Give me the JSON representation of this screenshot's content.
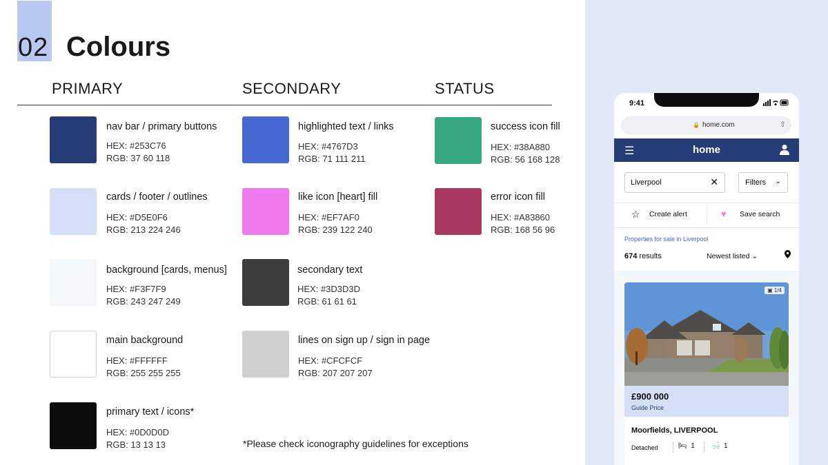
{
  "header": {
    "number": "02",
    "title": "Colours"
  },
  "columns": {
    "primary": "PRIMARY",
    "secondary": "SECONDARY",
    "status": "STATUS"
  },
  "primary": [
    {
      "label": "nav bar / primary buttons",
      "hex": "HEX: #253C76",
      "rgb": "RGB: 37 60 118",
      "color": "#253C76"
    },
    {
      "label": "cards / footer / outlines",
      "hex": "HEX: #D5E0F6",
      "rgb": "RGB: 213 224 246",
      "color": "#D5E0F6"
    },
    {
      "label": "background [cards, menus]",
      "hex": "HEX: #F3F7F9",
      "rgb": "RGB: 243 247 249",
      "color": "#F3F7F9"
    },
    {
      "label": "main background",
      "hex": "HEX: #FFFFFF",
      "rgb": "RGB: 255 255 255",
      "color": "#FFFFFF"
    },
    {
      "label": "primary text / icons*",
      "hex": "HEX: #0D0D0D",
      "rgb": "RGB: 13 13 13",
      "color": "#0D0D0D"
    }
  ],
  "secondary": [
    {
      "label": "highlighted text / links",
      "hex": "HEX: #4767D3",
      "rgb": "RGB: 71 111 211",
      "color": "#4767D3"
    },
    {
      "label": "like icon [heart] fill",
      "hex": "HEX: #EF7AF0",
      "rgb": "RGB: 239 122 240",
      "color": "#EF7AF0"
    },
    {
      "label": "secondary text",
      "hex": "HEX: #3D3D3D",
      "rgb": "RGB: 61 61 61",
      "color": "#3D3D3D"
    },
    {
      "label": "lines on sign up / sign in page",
      "hex": "HEX: #CFCFCF",
      "rgb": "RGB: 207 207 207",
      "color": "#CFCFCF"
    }
  ],
  "status": [
    {
      "label": "success icon fill",
      "hex": "HEX: #38A880",
      "rgb": "RGB: 56 168 128",
      "color": "#38A880"
    },
    {
      "label": "error icon fill",
      "hex": "HEX: #A83860",
      "rgb": "RGB: 168 56 96",
      "color": "#A83860"
    }
  ],
  "footnote": "*Please check iconography guidelines for exceptions",
  "phone": {
    "time": "9:41",
    "url": "home.com",
    "brand": "home",
    "location_value": "Liverpool",
    "filters_label": "Filters",
    "create_alert": "Create alert",
    "save_search": "Save search",
    "breadcrumb": "Properties for sale in Liverpool",
    "results_count": "674",
    "results_label": " results",
    "sort_label": "Newest listed",
    "photo_count": "1/4",
    "price": "£900 000",
    "price_qualifier": "Guide Price",
    "address": "Moorfields, LIVERPOOL",
    "property_type": "Detached",
    "beds": "1",
    "baths": "1"
  }
}
